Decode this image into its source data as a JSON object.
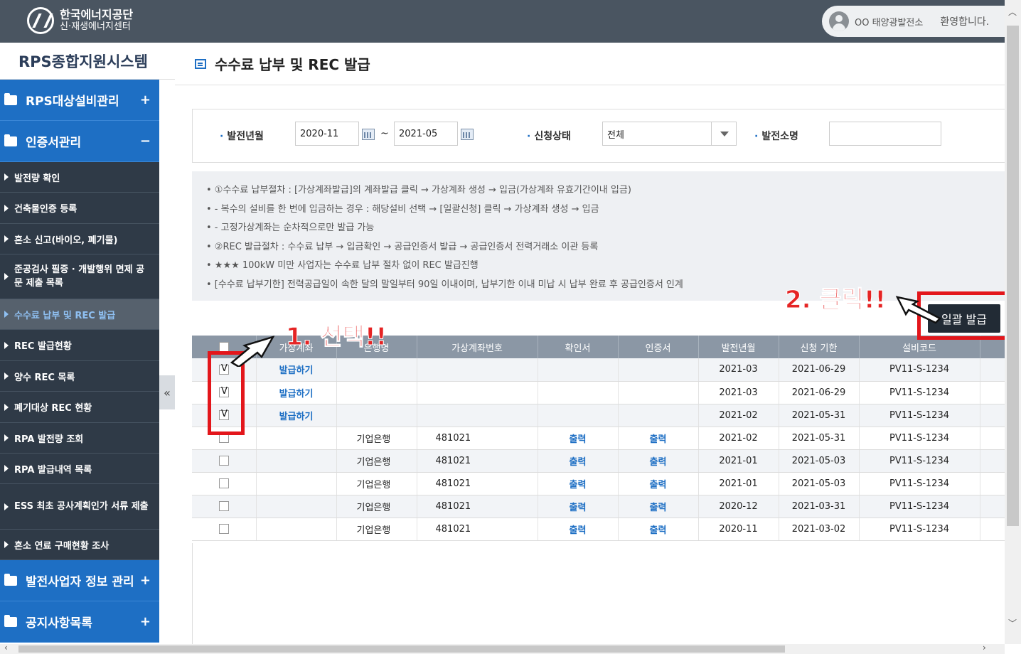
{
  "header": {
    "org_name": "한국에너지공단",
    "org_sub": "신·재생에너지센터",
    "user_name": "OO 태양광발전소",
    "welcome": "환영합니다."
  },
  "sidebar": {
    "system_title": "RPS종합지원시스템",
    "top_menus": [
      {
        "label": "RPS대상설비관리",
        "toggle": "+"
      },
      {
        "label": "인증서관리",
        "toggle": "−"
      },
      {
        "label": "발전사업자 정보 관리",
        "toggle": "+"
      },
      {
        "label": "공지사항목록",
        "toggle": "+"
      }
    ],
    "sub_items": [
      "발전량 확인",
      "건축물인증 등록",
      "혼소 신고(바이오, 폐기물)",
      "준공검사 필증 · 개발행위 면제 공문 제출 목록",
      "수수료 납부 및 REC 발급",
      "REC 발급현황",
      "양수 REC 목록",
      "폐기대상 REC 현황",
      "RPA 발전량 조회",
      "RPA 발급내역 목록",
      "ESS 최초 공사계획인가 서류 제출",
      "혼소 연료 구매현황 조사"
    ],
    "collapse_glyph": "«"
  },
  "page": {
    "title": "수수료 납부 및 REC 발급"
  },
  "search": {
    "period_label": "발전년월",
    "date_from": "2020-11",
    "tilde": "~",
    "date_to": "2021-05",
    "status_label": "신청상태",
    "status_value": "전체",
    "plant_label": "발전소명",
    "plant_value": ""
  },
  "notice": [
    "• ①수수료 납부절차 : [가상계좌발급]의 계좌발급 클릭 → 가상계좌 생성 → 입금(가상계좌 유효기간이내 입금)",
    "•     - 복수의 설비를 한 번에 입금하는 경우 : 해당설비 선택 → [일괄신청] 클릭 → 가상계좌 생성 → 입금",
    "•     - 고정가상계좌는 순차적으로만 발급 가능",
    "• ②REC 발급절차 : 수수료 납부 → 입금확인 → 공급인증서 발급 → 공급인증서 전력거래소 이관 등록",
    "•     ★★★ 100kW 미만 사업자는 수수료 납부 절차 없이 REC 발급진행",
    "• [수수료 납부기한] 전력공급일이 속한 달의 말일부터 90일 이내이며, 납부기한 이내 미납 시 납부 완료 후 공급인증서 인계"
  ],
  "annotations": {
    "step1": "1. 선택!!",
    "step2": "2. 클릭!!"
  },
  "bulk_button": "일괄 발급",
  "table": {
    "headers": [
      "가상계좌",
      "은행명",
      "가상계좌번호",
      "확인서",
      "인증서",
      "발전년월",
      "신청 기한",
      "설비코드"
    ],
    "rows": [
      {
        "checked": true,
        "vaccount": "발급하기",
        "bank": "",
        "account_no": "",
        "confirm": "",
        "cert": "",
        "month": "2021-03",
        "deadline": "2021-06-29",
        "code": "PV11-S-1234"
      },
      {
        "checked": true,
        "vaccount": "발급하기",
        "bank": "",
        "account_no": "",
        "confirm": "",
        "cert": "",
        "month": "2021-03",
        "deadline": "2021-06-29",
        "code": "PV11-S-1234"
      },
      {
        "checked": true,
        "vaccount": "발급하기",
        "bank": "",
        "account_no": "",
        "confirm": "",
        "cert": "",
        "month": "2021-02",
        "deadline": "2021-05-31",
        "code": "PV11-S-1234"
      },
      {
        "checked": false,
        "vaccount": "",
        "bank": "기업은행",
        "account_no": "481021",
        "confirm": "출력",
        "cert": "출력",
        "month": "2021-02",
        "deadline": "2021-05-31",
        "code": "PV11-S-1234"
      },
      {
        "checked": false,
        "vaccount": "",
        "bank": "기업은행",
        "account_no": "481021",
        "confirm": "출력",
        "cert": "출력",
        "month": "2021-01",
        "deadline": "2021-05-03",
        "code": "PV11-S-1234"
      },
      {
        "checked": false,
        "vaccount": "",
        "bank": "기업은행",
        "account_no": "481021",
        "confirm": "출력",
        "cert": "출력",
        "month": "2021-01",
        "deadline": "2021-05-03",
        "code": "PV11-S-1234"
      },
      {
        "checked": false,
        "vaccount": "",
        "bank": "기업은행",
        "account_no": "481021",
        "confirm": "출력",
        "cert": "출력",
        "month": "2020-12",
        "deadline": "2021-03-31",
        "code": "PV11-S-1234"
      },
      {
        "checked": false,
        "vaccount": "",
        "bank": "기업은행",
        "account_no": "481021",
        "confirm": "출력",
        "cert": "출력",
        "month": "2020-11",
        "deadline": "2021-03-02",
        "code": "PV11-S-1234"
      }
    ]
  },
  "colors": {
    "accent": "#1e6fc4",
    "topbar": "#4a5561",
    "sidebar_sub": "#2f3a47",
    "annotation_red": "#e3161b",
    "table_header": "#8b97a5"
  }
}
